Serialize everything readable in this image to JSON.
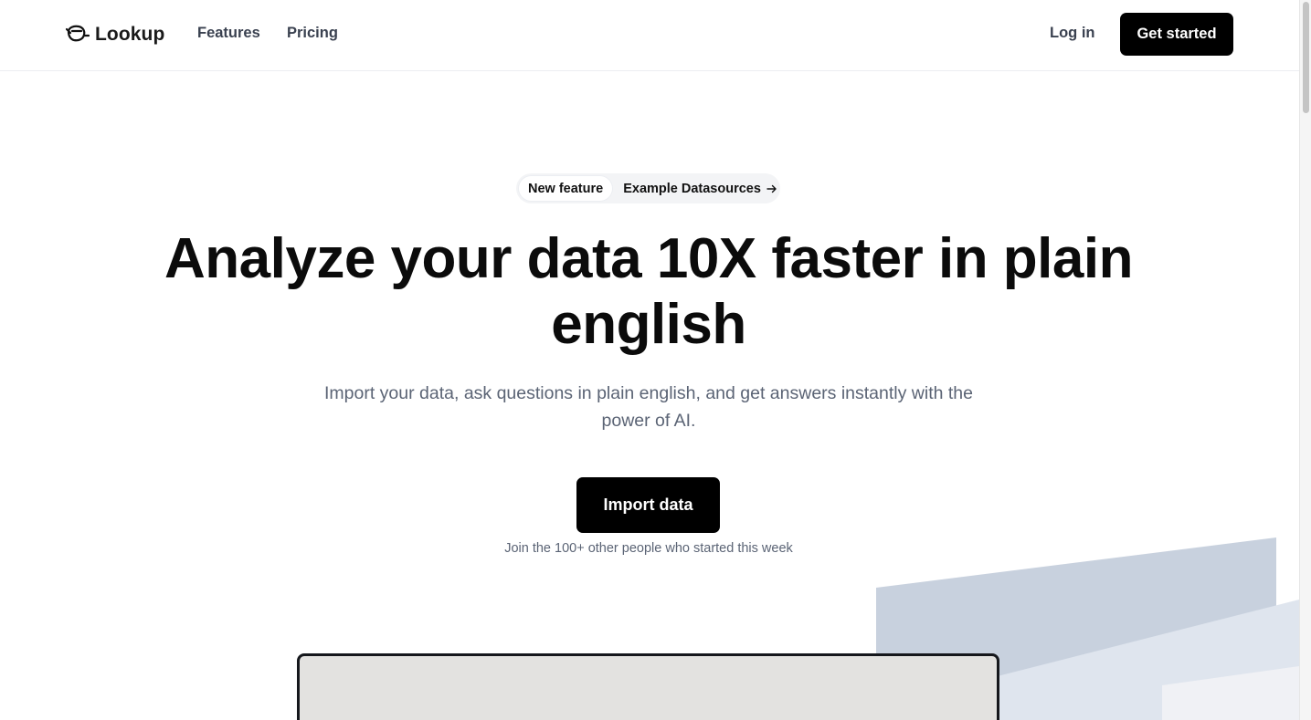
{
  "header": {
    "brand": "Lookup",
    "nav": [
      {
        "label": "Features"
      },
      {
        "label": "Pricing"
      }
    ],
    "login_label": "Log in",
    "cta_label": "Get started"
  },
  "hero": {
    "pill_badge": "New feature",
    "pill_text": "Example Datasources",
    "headline_line1": "Analyze your data 10X faster in plain",
    "headline_line2": "english",
    "subtitle_line1": "Import your data, ask questions in plain english, and get answers instantly with the",
    "subtitle_line2": "power of AI.",
    "import_button": "Import data",
    "join_text": "Join the 100+ other people who started this week"
  },
  "icons": {
    "logo": "lookup-logo-icon",
    "arrow": "arrow-right-icon"
  },
  "colors": {
    "primary": "#000000",
    "muted_text": "#5b6475",
    "nav_text": "#3a4150",
    "deco_dark": "#c8d1de",
    "deco_light": "#dfe5ee",
    "deco_lightest": "#f0f1f5"
  }
}
